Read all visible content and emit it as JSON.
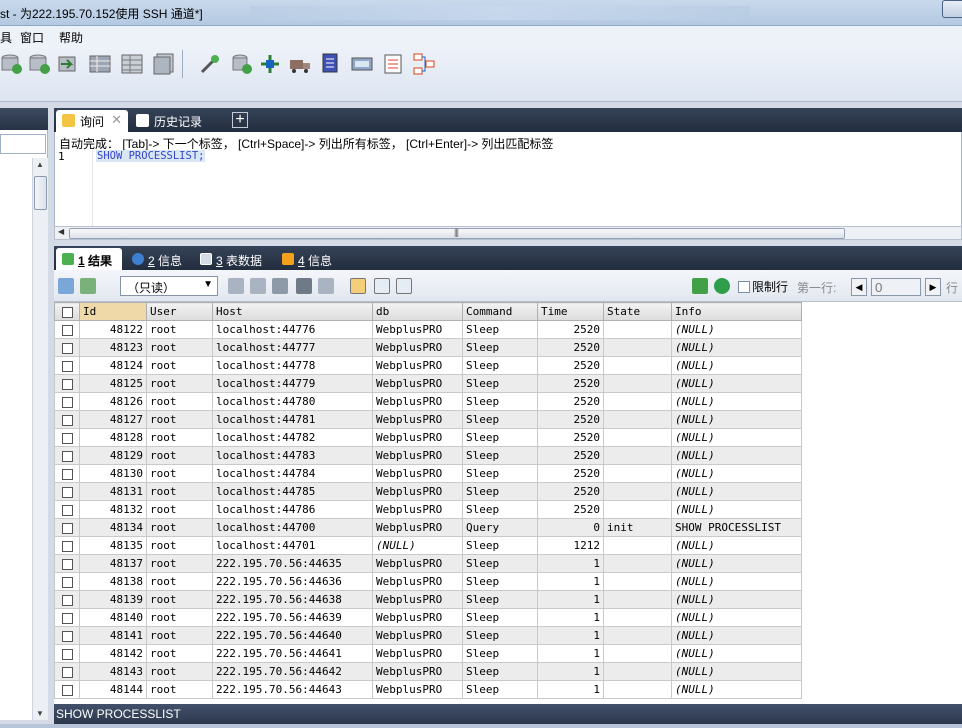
{
  "window": {
    "title": "st - 为222.195.70.152使用 SSH 通道*]"
  },
  "menubar": {
    "items": [
      "具",
      "窗口",
      "帮助"
    ]
  },
  "query_tabs": [
    {
      "label": "询问",
      "close": "✕"
    },
    {
      "label": "历史记录"
    }
  ],
  "editor": {
    "autocomplete_hint": "自动完成： [Tab]-> 下一个标签， [Ctrl+Space]-> 列出所有标签， [Ctrl+Enter]-> 列出匹配标签",
    "line_number": "1",
    "code": "SHOW PROCESSLIST;"
  },
  "result_tabs": [
    {
      "num": "1",
      "label": "结果"
    },
    {
      "num": "2",
      "label": "信息"
    },
    {
      "num": "3",
      "label": "表数据"
    },
    {
      "num": "4",
      "label": "信息"
    }
  ],
  "result_toolbar": {
    "readonly_select": "（只读）",
    "limit_rows_label": "限制行",
    "first_row_label": "第一行:",
    "first_row_value": "0",
    "rows_label": "行"
  },
  "colors": {
    "dark_header": "#2a3548",
    "id_header": "#f0d9a8",
    "accent_blue": "#3645c9"
  },
  "table": {
    "columns": [
      "Id",
      "User",
      "Host",
      "db",
      "Command",
      "Time",
      "State",
      "Info"
    ],
    "rows": [
      [
        "48122",
        "root",
        "localhost:44776",
        "WebplusPRO",
        "Sleep",
        "2520",
        "",
        "(NULL)"
      ],
      [
        "48123",
        "root",
        "localhost:44777",
        "WebplusPRO",
        "Sleep",
        "2520",
        "",
        "(NULL)"
      ],
      [
        "48124",
        "root",
        "localhost:44778",
        "WebplusPRO",
        "Sleep",
        "2520",
        "",
        "(NULL)"
      ],
      [
        "48125",
        "root",
        "localhost:44779",
        "WebplusPRO",
        "Sleep",
        "2520",
        "",
        "(NULL)"
      ],
      [
        "48126",
        "root",
        "localhost:44780",
        "WebplusPRO",
        "Sleep",
        "2520",
        "",
        "(NULL)"
      ],
      [
        "48127",
        "root",
        "localhost:44781",
        "WebplusPRO",
        "Sleep",
        "2520",
        "",
        "(NULL)"
      ],
      [
        "48128",
        "root",
        "localhost:44782",
        "WebplusPRO",
        "Sleep",
        "2520",
        "",
        "(NULL)"
      ],
      [
        "48129",
        "root",
        "localhost:44783",
        "WebplusPRO",
        "Sleep",
        "2520",
        "",
        "(NULL)"
      ],
      [
        "48130",
        "root",
        "localhost:44784",
        "WebplusPRO",
        "Sleep",
        "2520",
        "",
        "(NULL)"
      ],
      [
        "48131",
        "root",
        "localhost:44785",
        "WebplusPRO",
        "Sleep",
        "2520",
        "",
        "(NULL)"
      ],
      [
        "48132",
        "root",
        "localhost:44786",
        "WebplusPRO",
        "Sleep",
        "2520",
        "",
        "(NULL)"
      ],
      [
        "48134",
        "root",
        "localhost:44700",
        "WebplusPRO",
        "Query",
        "0",
        "init",
        "SHOW PROCESSLIST"
      ],
      [
        "48135",
        "root",
        "localhost:44701",
        "(NULL)",
        "Sleep",
        "1212",
        "",
        "(NULL)"
      ],
      [
        "48137",
        "root",
        "222.195.70.56:44635",
        "WebplusPRO",
        "Sleep",
        "1",
        "",
        "(NULL)"
      ],
      [
        "48138",
        "root",
        "222.195.70.56:44636",
        "WebplusPRO",
        "Sleep",
        "1",
        "",
        "(NULL)"
      ],
      [
        "48139",
        "root",
        "222.195.70.56:44638",
        "WebplusPRO",
        "Sleep",
        "1",
        "",
        "(NULL)"
      ],
      [
        "48140",
        "root",
        "222.195.70.56:44639",
        "WebplusPRO",
        "Sleep",
        "1",
        "",
        "(NULL)"
      ],
      [
        "48141",
        "root",
        "222.195.70.56:44640",
        "WebplusPRO",
        "Sleep",
        "1",
        "",
        "(NULL)"
      ],
      [
        "48142",
        "root",
        "222.195.70.56:44641",
        "WebplusPRO",
        "Sleep",
        "1",
        "",
        "(NULL)"
      ],
      [
        "48143",
        "root",
        "222.195.70.56:44642",
        "WebplusPRO",
        "Sleep",
        "1",
        "",
        "(NULL)"
      ],
      [
        "48144",
        "root",
        "222.195.70.56:44643",
        "WebplusPRO",
        "Sleep",
        "1",
        "",
        "(NULL)"
      ]
    ]
  },
  "status": {
    "text": "SHOW PROCESSLIST"
  }
}
